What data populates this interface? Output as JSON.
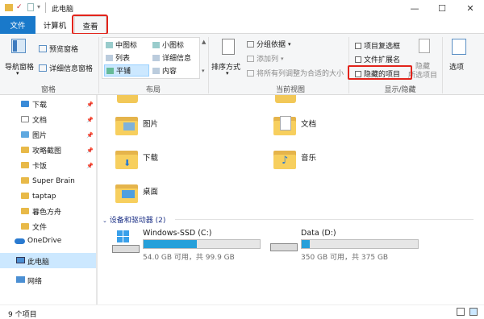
{
  "window": {
    "title": "此电脑",
    "minimize": "—",
    "maximize": "☐",
    "close": "✕"
  },
  "tabs": {
    "file": "文件",
    "computer": "计算机",
    "view": "查看"
  },
  "ribbon": {
    "panes": {
      "nav_pane": "导航窗格",
      "preview_pane": "预览窗格",
      "details_pane": "详细信息窗格",
      "group": "窗格"
    },
    "layout": {
      "medium_icons": "中图标",
      "small_icons": "小图标",
      "list": "列表",
      "details": "详细信息",
      "tiles": "平铺",
      "content": "内容",
      "group": "布局"
    },
    "current_view": {
      "sort_by": "排序方式",
      "group_by": "分组依据",
      "add_column": "添加列",
      "size_all_columns": "将所有列调整为合适的大小",
      "group": "当前视图"
    },
    "show_hide": {
      "item_checkboxes": "项目复选框",
      "file_extensions": "文件扩展名",
      "hidden_items": "隐藏的项目",
      "hide_selected": "隐藏",
      "hide_selected_2": "所选项目",
      "group": "显示/隐藏"
    },
    "options": "选项"
  },
  "nav": {
    "items": [
      {
        "label": "下载",
        "pinned": true
      },
      {
        "label": "文档",
        "pinned": true
      },
      {
        "label": "图片",
        "pinned": true
      },
      {
        "label": "攻略截图",
        "pinned": true
      },
      {
        "label": "卡饭",
        "pinned": true
      },
      {
        "label": "Super Brain",
        "pinned": false
      },
      {
        "label": "taptap",
        "pinned": false
      },
      {
        "label": "暮色方舟",
        "pinned": false
      },
      {
        "label": "文件",
        "pinned": false
      }
    ],
    "onedrive": "OneDrive",
    "this_pc": "此电脑",
    "network": "网络"
  },
  "content": {
    "folders": {
      "pictures": "图片",
      "documents": "文档",
      "downloads": "下载",
      "music": "音乐",
      "desktop": "桌面"
    },
    "devices_header": "设备和驱动器 (2)",
    "drives": [
      {
        "name": "Windows-SSD (C:)",
        "free_text": "54.0 GB 可用，共 99.9 GB",
        "used_fraction": 0.46
      },
      {
        "name": "Data (D:)",
        "free_text": "350 GB 可用，共 375 GB",
        "used_fraction": 0.07
      }
    ]
  },
  "status": {
    "count": "9 个项目"
  }
}
